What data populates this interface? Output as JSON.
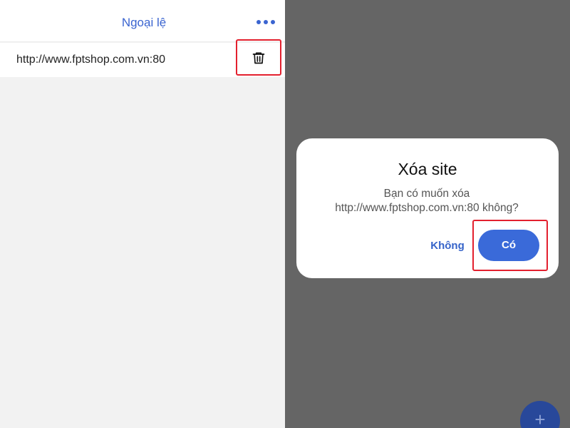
{
  "exceptions_panel": {
    "title": "Ngoại lệ",
    "more_icon": "more-horizontal-icon",
    "items": [
      {
        "url": "http://www.fptshop.com.vn:80",
        "action_icon": "trash-icon"
      }
    ]
  },
  "delete_dialog": {
    "title": "Xóa site",
    "message": "Bạn có muốn xóa http://www.fptshop.com.vn:80 không?",
    "cancel_label": "Không",
    "confirm_label": "Có"
  },
  "fab": {
    "label": "+",
    "icon": "plus-icon"
  },
  "colors": {
    "accent": "#3a64d0",
    "highlight": "#e3202e",
    "overlay": "#656565",
    "confirm_button": "#3a6ad9"
  }
}
